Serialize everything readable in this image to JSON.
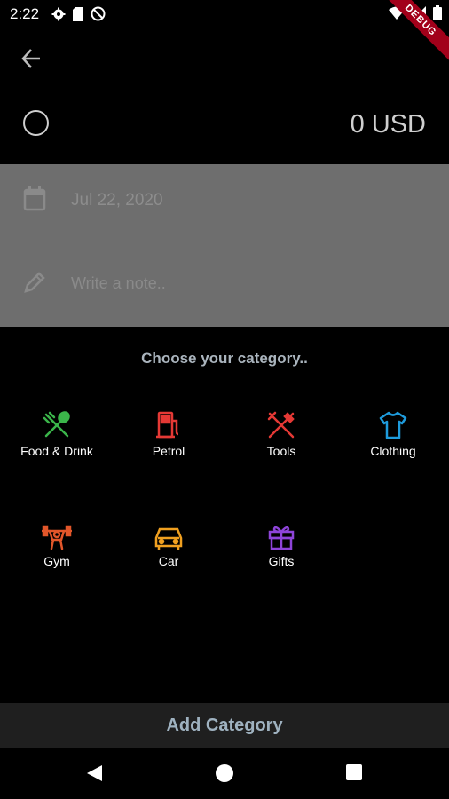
{
  "status_bar": {
    "time": "2:22",
    "debug_label": "DEBUG"
  },
  "header": {
    "amount": "0 USD"
  },
  "form": {
    "date": "Jul 22, 2020",
    "note_placeholder": "Write a note.."
  },
  "categories": {
    "title": "Choose your category..",
    "items": [
      {
        "label": "Food & Drink",
        "icon": "fork-spoon-icon",
        "color": "#3bb54a"
      },
      {
        "label": "Petrol",
        "icon": "gas-station-icon",
        "color": "#e53935"
      },
      {
        "label": "Tools",
        "icon": "fork-knife-icon",
        "color": "#e53935"
      },
      {
        "label": "Clothing",
        "icon": "tshirt-icon",
        "color": "#1e9bdc"
      },
      {
        "label": "Gym",
        "icon": "weightlifter-icon",
        "color": "#e2562a"
      },
      {
        "label": "Car",
        "icon": "car-icon",
        "color": "#f0a020"
      },
      {
        "label": "Gifts",
        "icon": "gift-icon",
        "color": "#8e44d9"
      }
    ]
  },
  "add_button": {
    "label": "Add Category"
  }
}
